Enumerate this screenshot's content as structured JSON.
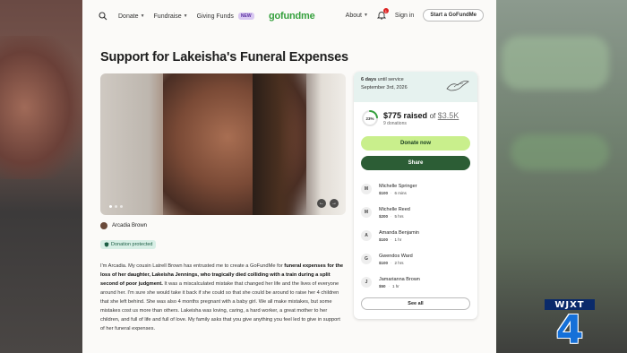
{
  "header": {
    "nav": [
      {
        "label": "Donate",
        "has_chevron": true
      },
      {
        "label": "Fundraise",
        "has_chevron": true
      },
      {
        "label": "Giving Funds",
        "badge": "NEW",
        "has_chevron": false
      }
    ],
    "logo": "gofundme",
    "about": "About",
    "notification_count": "1",
    "signin": "Sign in",
    "start": "Start a GoFundMe"
  },
  "campaign": {
    "title": "Support for Lakeisha's Funeral Expenses",
    "organizer": "Arcadia Brown",
    "protected_label": "Donation protected",
    "story": {
      "p1": "I'm Arcadia. My cousin Latrell Brown has entrusted me to create a GoFundMe for ",
      "b1": "funeral expenses for the loss of her daughter, Lakeisha Jennings, who tragically died colliding with a train during a split second of poor judgment.",
      "p2": " It was a miscalculated mistake that changed her life and the lives of everyone around her. I'm sure she would take it back if she could so that she could be around to raise her 4 children that she left behind. She was also 4 months pregnant with a baby girl. We all make mistakes, but some mistakes cost us more than others. Lakeisha was loving, caring, a hard worker, a great mother to her children, and full of life and full of love. My family asks that you give anything you feel led to give in support of her funeral expenses."
    }
  },
  "panel": {
    "countdown_days": "6 days",
    "countdown_suffix": "until service",
    "service_date": "September 3rd, 2026",
    "percent": "23%",
    "percent_value": 0.23,
    "raised": "$775 raised",
    "of": "of",
    "goal": "$3.5K",
    "donations_count": "9 donations",
    "donate_label": "Donate now",
    "share_label": "Share",
    "donors": [
      {
        "initial": "M",
        "name": "Michelle Springer",
        "amount": "$100",
        "time": "6 mins"
      },
      {
        "initial": "M",
        "name": "Michelle Reed",
        "amount": "$200",
        "time": "5 hrs"
      },
      {
        "initial": "A",
        "name": "Amanda Benjamin",
        "amount": "$100",
        "time": "1 hr"
      },
      {
        "initial": "G",
        "name": "Gwendos Ward",
        "amount": "$100",
        "time": "2 hrs"
      },
      {
        "initial": "J",
        "name": "Jamarianna Brown",
        "amount": "$50",
        "time": "1 hr"
      }
    ],
    "see_all": "See all"
  },
  "station": {
    "call_sign": "WJXT",
    "channel": "4"
  },
  "colors": {
    "brand_green": "#35a03d",
    "donate_button": "#c9ef8c",
    "share_button": "#2c5d35",
    "station_blue": "#1570d8"
  }
}
